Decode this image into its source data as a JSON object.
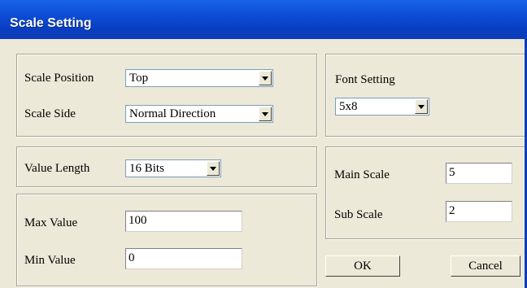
{
  "window": {
    "title": "Scale Setting"
  },
  "scale_position": {
    "label": "Scale Position",
    "value": "Top"
  },
  "scale_side": {
    "label": "Scale Side",
    "value": "Normal Direction"
  },
  "font_setting": {
    "label": "Font Setting",
    "value": "5x8"
  },
  "value_length": {
    "label": "Value Length",
    "value": "16 Bits"
  },
  "main_scale": {
    "label": "Main Scale",
    "value": "5"
  },
  "sub_scale": {
    "label": "Sub Scale",
    "value": "2"
  },
  "max_value": {
    "label": "Max Value",
    "value": "100"
  },
  "min_value": {
    "label": "Min Value",
    "value": "0"
  },
  "buttons": {
    "ok": "OK",
    "cancel": "Cancel"
  },
  "colors": {
    "titlebar": "#0a3fc4",
    "face": "#ece9d8"
  }
}
